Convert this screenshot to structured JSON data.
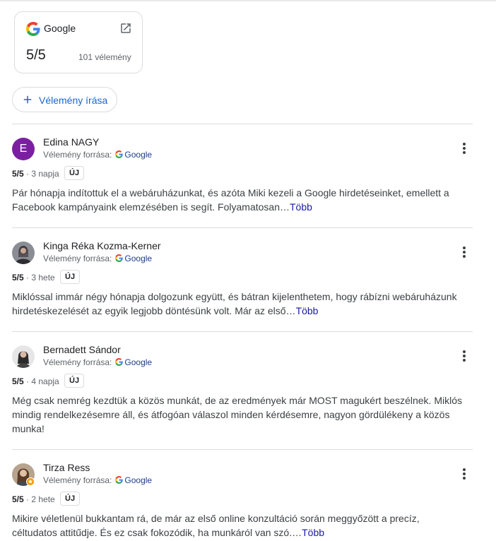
{
  "source_card": {
    "name": "Google",
    "score": "5/5",
    "count": "101 vélemény",
    "logo_icon": "google-g-logo",
    "external_icon": "open-in-new-icon"
  },
  "write_review": {
    "label": "Vélemény írása",
    "icon": "plus-icon"
  },
  "source_prefix": "Vélemény forrása:",
  "source_name": "Google",
  "new_badge": "ÚJ",
  "more_label": "Több",
  "reviews": [
    {
      "author": "Edina NAGY",
      "avatar_letter": "E",
      "score": "5/5",
      "time": " · 3 napja",
      "text": "Pár hónapja indítottuk el a webáruházunkat, és azóta Miki kezeli a Google hirdetéseinket, emellett a Facebook kampányaink elemzésében is segít. Folyamatosan…",
      "has_more": true
    },
    {
      "author": "Kinga Réka Kozma-Kerner",
      "score": "5/5",
      "time": " · 3 hete",
      "text": "Miklóssal immár négy hónapja dolgozunk együtt, és bátran kijelenthetem, hogy rábízni webáruházunk hirdetéskezelését az egyik legjobb döntésünk volt. Már az első…",
      "has_more": true
    },
    {
      "author": "Bernadett Sándor",
      "score": "5/5",
      "time": " · 4 napja",
      "text": "Még csak nemrég kezdtük a közös munkát, de az eredmények már MOST magukért beszélnek. Miklós mindig rendelkezésemre áll, és átfogóan válaszol minden kérdésemre, nagyon gördülékeny a közös munka!",
      "has_more": false
    },
    {
      "author": "Tirza Ress",
      "score": "5/5",
      "time": " · 2 hete",
      "text": "Mikire véletlenül bukkantam rá, de már az első online konzultáció során meggyőzött a precíz, céltudatos attitűdje. És ez csak fokozódik, ha munkáról van szó.…",
      "has_more": true
    }
  ],
  "colors": {
    "accent_blue": "#1967d2",
    "link": "#1a1aa6",
    "avatar_purple": "#7b1fa2",
    "divider": "#dadce0"
  }
}
